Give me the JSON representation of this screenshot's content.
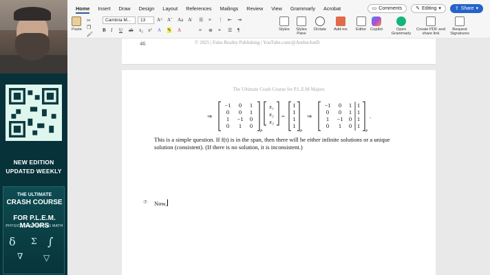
{
  "ribbon": {
    "tabs": [
      "Home",
      "Insert",
      "Draw",
      "Design",
      "Layout",
      "References",
      "Mailings",
      "Review",
      "View",
      "Grammarly",
      "Acrobat"
    ],
    "active_tab": "Home",
    "comments_label": "Comments",
    "editing_label": "Editing",
    "share_label": "Share",
    "font_name": "Cambria M...",
    "font_size": "13",
    "paste_label": "Paste",
    "styles_label": "Styles",
    "styles_pane_label": "Styles Pane",
    "dictate_label": "Dictate",
    "addins_label": "Add-ins",
    "editor_label": "Editor",
    "copilot_label": "Copilot",
    "open_grammarly_label": "Open Grammarly",
    "create_pdf_label": "Create PDF and share link",
    "request_signatures_label": "Request Signatures",
    "colors": {
      "accent": "#2b579a",
      "share": "#2563c9"
    }
  },
  "promo": {
    "new_edition": "NEW EDITION",
    "updated_weekly": "UPDATED WEEKLY",
    "book_the": "THE ULTIMATE",
    "book_crash": "CRASH COURSE",
    "book_for": "FOR P.L.E.M. MAJORS",
    "book_sub": "PHYSICS ENGINEERING MATH"
  },
  "document": {
    "prev_page_number": "46",
    "prev_footer": "© 2025 | False Reality Publishing | YouTube.com/@AuthorJonD",
    "header": "The Ultimate Crash Course for P.L.E.M Majors",
    "paragraph1": "This is a simple question. If f(t) is in the span, then there will be either infinite solutions or a unique solution (consistent). (If there is no solution, it is inconsistent.)",
    "paragraph2": "Now,",
    "equation_matrix": [
      [
        "−1",
        "0",
        "1"
      ],
      [
        "0",
        "0",
        "1"
      ],
      [
        "1",
        "−1",
        "0"
      ],
      [
        "0",
        "1",
        "0"
      ]
    ],
    "equation_vars": [
      "x1",
      "x2",
      "x3"
    ],
    "equation_rhs": [
      "1",
      "1",
      "1",
      "1"
    ],
    "augmented": [
      [
        "−1",
        "0",
        "1",
        "1"
      ],
      [
        "0",
        "0",
        "1",
        "1"
      ],
      [
        "1",
        "−1",
        "0",
        "1"
      ],
      [
        "0",
        "1",
        "0",
        "1"
      ]
    ]
  }
}
